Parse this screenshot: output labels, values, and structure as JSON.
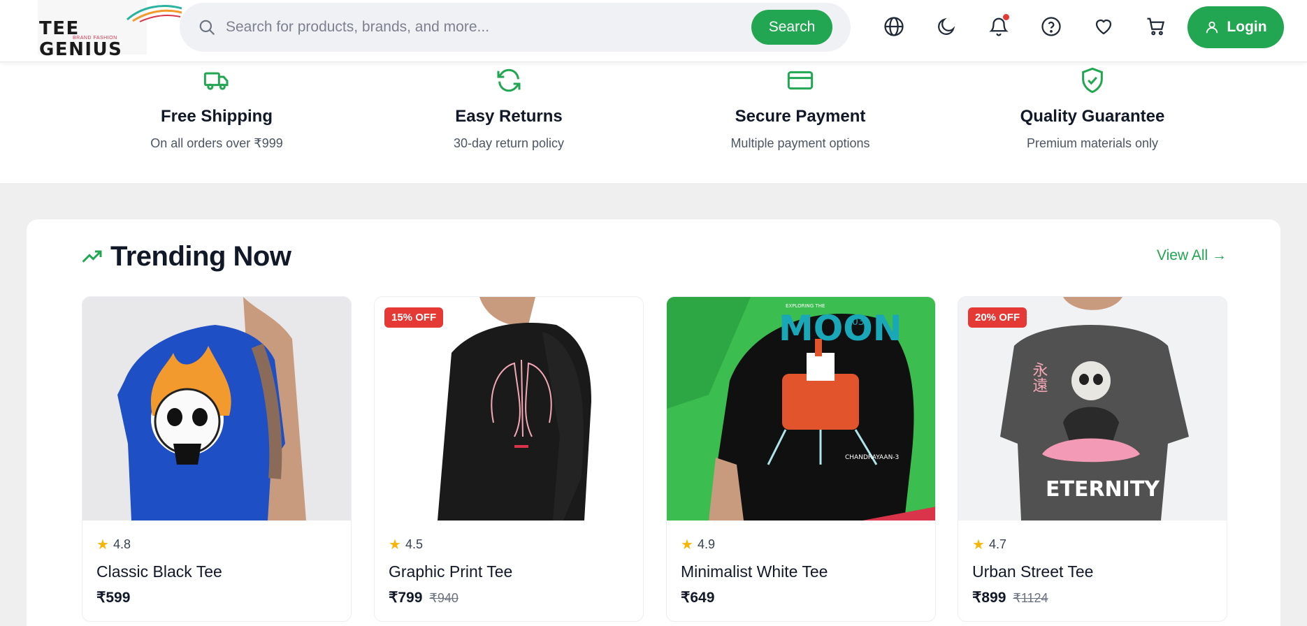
{
  "header": {
    "logo_text": "TEE GENIUS",
    "logo_sub": "BRAND FASHION",
    "search_placeholder": "Search for products, brands, and more...",
    "search_button": "Search",
    "login_label": "Login",
    "icons": [
      "globe-icon",
      "moon-icon",
      "bell-icon",
      "help-icon",
      "heart-icon",
      "cart-icon"
    ]
  },
  "features": [
    {
      "title": "Free Shipping",
      "desc": "On all orders over ₹999",
      "icon": "truck-icon"
    },
    {
      "title": "Easy Returns",
      "desc": "30-day return policy",
      "icon": "refresh-icon"
    },
    {
      "title": "Secure Payment",
      "desc": "Multiple payment options",
      "icon": "credit-card-icon"
    },
    {
      "title": "Quality Guarantee",
      "desc": "Premium materials only",
      "icon": "shield-check-icon"
    }
  ],
  "trending": {
    "title": "Trending Now",
    "view_all": "View All →",
    "products": [
      {
        "name": "Classic Black Tee",
        "rating": "4.8",
        "price": "₹599",
        "old_price": "",
        "badge": ""
      },
      {
        "name": "Graphic Print Tee",
        "rating": "4.5",
        "price": "₹799",
        "old_price": "₹940",
        "badge": "15% OFF"
      },
      {
        "name": "Minimalist White Tee",
        "rating": "4.9",
        "price": "₹649",
        "old_price": "",
        "badge": ""
      },
      {
        "name": "Urban Street Tee",
        "rating": "4.7",
        "price": "₹899",
        "old_price": "₹1124",
        "badge": "20% OFF"
      }
    ],
    "image_text": {
      "moon_small": "EXPLORING THE",
      "moon_big": "MOON",
      "moon_num": "03",
      "moon_caption": "CHANDRAYAAN-3",
      "eternity": "ETERNITY",
      "kanji": "永遠"
    }
  },
  "colors": {
    "accent": "#22a652",
    "badge": "#e53935",
    "star": "#f5b50a"
  }
}
